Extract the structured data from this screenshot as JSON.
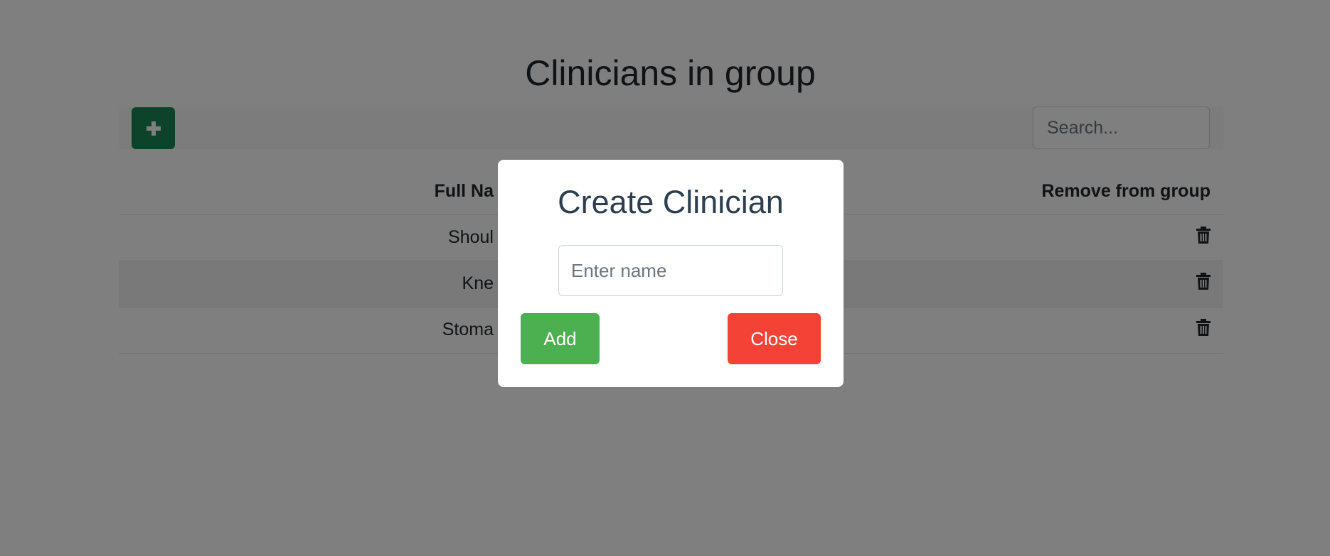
{
  "page": {
    "title": "Clinicians in group"
  },
  "toolbar": {
    "add_icon": "plus-icon",
    "search_placeholder": "Search..."
  },
  "table": {
    "headers": {
      "name": "Full Na",
      "remove": "Remove from group"
    },
    "rows": [
      {
        "name": "Shoul",
        "remove_icon": "trash-icon"
      },
      {
        "name": "Kne",
        "remove_icon": "trash-icon"
      },
      {
        "name": "Stoma",
        "remove_icon": "trash-icon"
      }
    ]
  },
  "modal": {
    "title": "Create Clinician",
    "name_placeholder": "Enter name",
    "add_label": "Add",
    "close_label": "Close"
  },
  "colors": {
    "add_button": "#198754",
    "modal_add": "#4caf50",
    "modal_close": "#f44336",
    "overlay": "rgba(0,0,0,0.5)"
  }
}
